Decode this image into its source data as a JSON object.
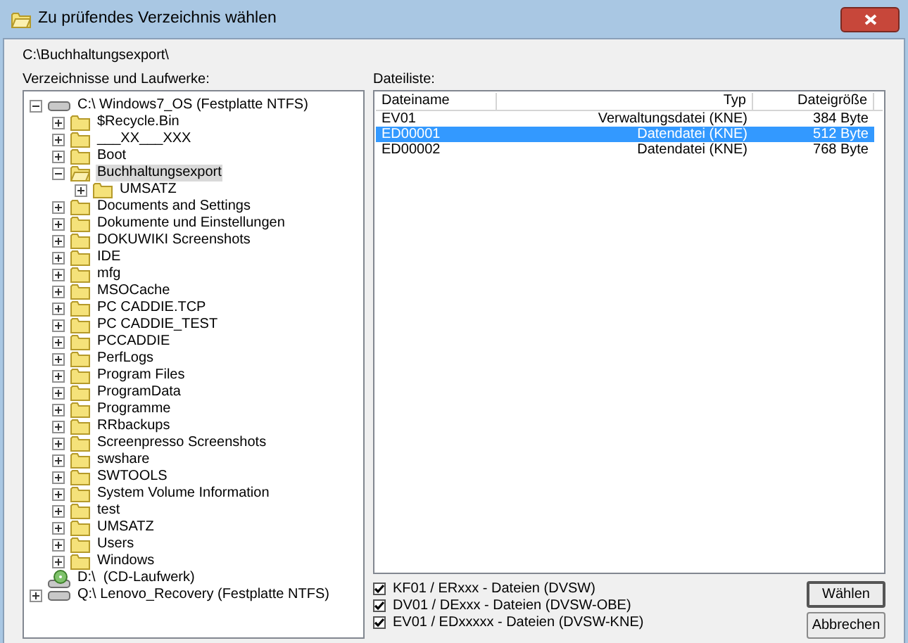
{
  "window": {
    "title": "Zu prüfendes Verzeichnis wählen"
  },
  "current_path": "C:\\Buchhaltungsexport\\",
  "tree_label": "Verzeichnisse und Laufwerke:",
  "tree": [
    {
      "kind": "drive",
      "label": "C:\\ Windows7_OS (Festplatte NTFS)",
      "expanded": true,
      "selected": false,
      "children": [
        {
          "kind": "folder",
          "label": "$Recycle.Bin",
          "expanded": false,
          "selected": false
        },
        {
          "kind": "folder",
          "label": "___XX___XXX",
          "expanded": false,
          "selected": false
        },
        {
          "kind": "folder",
          "label": "Boot",
          "expanded": false,
          "selected": false
        },
        {
          "kind": "folder",
          "label": "Buchhaltungsexport",
          "expanded": true,
          "selected": true,
          "children": [
            {
              "kind": "folder",
              "label": "UMSATZ",
              "expanded": false,
              "selected": false
            }
          ]
        },
        {
          "kind": "folder",
          "label": "Documents and Settings",
          "expanded": false,
          "selected": false
        },
        {
          "kind": "folder",
          "label": "Dokumente und Einstellungen",
          "expanded": false,
          "selected": false
        },
        {
          "kind": "folder",
          "label": "DOKUWIKI Screenshots",
          "expanded": false,
          "selected": false
        },
        {
          "kind": "folder",
          "label": "IDE",
          "expanded": false,
          "selected": false
        },
        {
          "kind": "folder",
          "label": "mfg",
          "expanded": false,
          "selected": false
        },
        {
          "kind": "folder",
          "label": "MSOCache",
          "expanded": false,
          "selected": false
        },
        {
          "kind": "folder",
          "label": "PC CADDIE.TCP",
          "expanded": false,
          "selected": false
        },
        {
          "kind": "folder",
          "label": "PC CADDIE_TEST",
          "expanded": false,
          "selected": false
        },
        {
          "kind": "folder",
          "label": "PCCADDIE",
          "expanded": false,
          "selected": false
        },
        {
          "kind": "folder",
          "label": "PerfLogs",
          "expanded": false,
          "selected": false
        },
        {
          "kind": "folder",
          "label": "Program Files",
          "expanded": false,
          "selected": false
        },
        {
          "kind": "folder",
          "label": "ProgramData",
          "expanded": false,
          "selected": false
        },
        {
          "kind": "folder",
          "label": "Programme",
          "expanded": false,
          "selected": false
        },
        {
          "kind": "folder",
          "label": "RRbackups",
          "expanded": false,
          "selected": false
        },
        {
          "kind": "folder",
          "label": "Screenpresso Screenshots",
          "expanded": false,
          "selected": false
        },
        {
          "kind": "folder",
          "label": "swshare",
          "expanded": false,
          "selected": false
        },
        {
          "kind": "folder",
          "label": "SWTOOLS",
          "expanded": false,
          "selected": false
        },
        {
          "kind": "folder",
          "label": "System Volume Information",
          "expanded": false,
          "selected": false
        },
        {
          "kind": "folder",
          "label": "test",
          "expanded": false,
          "selected": false
        },
        {
          "kind": "folder",
          "label": "UMSATZ",
          "expanded": false,
          "selected": false
        },
        {
          "kind": "folder",
          "label": "Users",
          "expanded": false,
          "selected": false
        },
        {
          "kind": "folder",
          "label": "Windows",
          "expanded": false,
          "selected": false
        }
      ]
    },
    {
      "kind": "cd",
      "label": "D:\\  (CD-Laufwerk)",
      "selected": false
    },
    {
      "kind": "drive",
      "label": "Q:\\ Lenovo_Recovery (Festplatte NTFS)",
      "expanded": false,
      "selected": false
    }
  ],
  "file_list_label": "Dateiliste:",
  "file_table": {
    "columns": [
      "Dateiname",
      "Typ",
      "Dateigröße"
    ],
    "rows": [
      {
        "cells": [
          "EV01",
          "Verwaltungsdatei (KNE)",
          "384 Byte"
        ],
        "selected": false
      },
      {
        "cells": [
          "ED00001",
          "Datendatei (KNE)",
          "512 Byte"
        ],
        "selected": true
      },
      {
        "cells": [
          "ED00002",
          "Datendatei (KNE)",
          "768 Byte"
        ],
        "selected": false
      }
    ]
  },
  "filters": [
    {
      "label": "KF01 / ERxxx - Dateien (DVSW)",
      "checked": true
    },
    {
      "label": "DV01 / DExxx - Dateien (DVSW-OBE)",
      "checked": true
    },
    {
      "label": "EV01 / EDxxxxx - Dateien (DVSW-KNE)",
      "checked": true
    }
  ],
  "buttons": [
    "Wählen",
    "Abbrechen"
  ]
}
